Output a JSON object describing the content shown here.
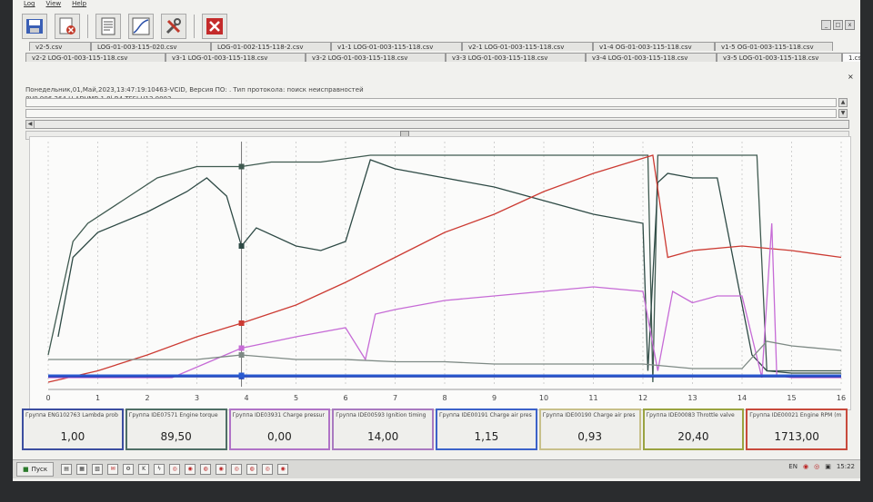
{
  "menu": [
    "Log",
    "View",
    "Help"
  ],
  "toolbar": {
    "icons": [
      "save-icon",
      "delete-icon",
      "notes-icon",
      "graph-icon",
      "settings-icon",
      "exit-icon"
    ]
  },
  "tabs": {
    "row1": [
      "v2-5.csv",
      "LOG-01-003-115-020.csv",
      "LOG-01-002-115-118-2.csv",
      "v1-1 LOG-01-003-115-118.csv",
      "v2-1 LOG-01-003-115-118.csv",
      "v1-4 OG-01-003-115-118.csv",
      "v1-5 OG-01-003-115-118.csv"
    ],
    "row2": [
      "v2-2 LOG-01-003-115-118.csv",
      "v3-1 LOG-01-003-115-118.csv",
      "v3-2 LOG-01-003-115-118.csv",
      "v3-3 LOG-01-003-115-118.csv",
      "v3-4 LOG-01-003-115-118.csv",
      "v3-5 LOG-01-003-115-118.csv",
      "1.csv"
    ]
  },
  "info": {
    "line1": "Понедельник,01,Май,2023,13:47:19:10463-VCID, Версия ПО: . Тип протокола: поиск неисправностей",
    "line2": "8V0 906 264 H ADVMB 1.8l R4 TFSI  H13 0003"
  },
  "chart_data": {
    "type": "line",
    "x_ticks": [
      0,
      1,
      2,
      3,
      4,
      5,
      6,
      7,
      8,
      9,
      10,
      11,
      12,
      13,
      14,
      15,
      16
    ],
    "xlim": [
      0,
      16
    ],
    "cursor_x": 3.9,
    "grid": true,
    "series": [
      {
        "color": "#3f5a50",
        "x": [
          0,
          0.5,
          0.8,
          1.5,
          2.2,
          3,
          3.5,
          3.9,
          4.5,
          5.5,
          6.5,
          7,
          8,
          9,
          10,
          11,
          12.1,
          12.2,
          12.3,
          14.3,
          14.5,
          15,
          16
        ],
        "y": [
          0.12,
          0.62,
          0.7,
          0.8,
          0.9,
          0.95,
          0.95,
          0.95,
          0.97,
          0.97,
          1.0,
          1.0,
          1.0,
          1.0,
          1.0,
          1.0,
          1.0,
          0.0,
          1.0,
          1.0,
          0.05,
          0.05,
          0.05
        ]
      },
      {
        "color": "#2e4a45",
        "x": [
          0.2,
          0.5,
          1.0,
          2.0,
          2.8,
          3.2,
          3.6,
          3.9,
          4.2,
          5.0,
          5.5,
          6.0,
          6.5,
          7,
          8,
          9,
          10,
          11,
          12.0,
          12.1,
          12.3,
          12.5,
          13,
          13.5,
          14.2,
          14.5,
          15,
          16
        ],
        "y": [
          0.2,
          0.55,
          0.66,
          0.75,
          0.84,
          0.9,
          0.82,
          0.6,
          0.68,
          0.6,
          0.58,
          0.62,
          0.98,
          0.94,
          0.9,
          0.86,
          0.8,
          0.74,
          0.7,
          0.05,
          0.88,
          0.92,
          0.9,
          0.9,
          0.12,
          0.05,
          0.04,
          0.04
        ]
      },
      {
        "color": "#cc3b33",
        "x": [
          0,
          1,
          2,
          3,
          3.9,
          5,
          6,
          7,
          8,
          9,
          10,
          11,
          12.2,
          12.5,
          13,
          14,
          15,
          16
        ],
        "y": [
          0.0,
          0.05,
          0.12,
          0.2,
          0.26,
          0.34,
          0.44,
          0.55,
          0.66,
          0.74,
          0.84,
          0.92,
          1.0,
          0.55,
          0.58,
          0.6,
          0.58,
          0.55
        ]
      },
      {
        "color": "#c66bd6",
        "x": [
          0,
          2.5,
          3.9,
          5,
          6,
          6.4,
          6.6,
          7,
          8,
          9,
          10,
          11,
          12,
          12.3,
          12.6,
          13,
          13.5,
          14,
          14.4,
          14.6,
          14.7,
          15,
          16
        ],
        "y": [
          0.02,
          0.02,
          0.15,
          0.2,
          0.24,
          0.1,
          0.3,
          0.32,
          0.36,
          0.38,
          0.4,
          0.42,
          0.4,
          0.05,
          0.4,
          0.35,
          0.38,
          0.38,
          0.02,
          0.7,
          0.03,
          0.02,
          0.02
        ]
      },
      {
        "color": "#7e8a85",
        "x": [
          0,
          1,
          2,
          3,
          3.9,
          5,
          6,
          7,
          8,
          9,
          10,
          11,
          12,
          13,
          14,
          14.5,
          15,
          16
        ],
        "y": [
          0.1,
          0.1,
          0.1,
          0.1,
          0.12,
          0.1,
          0.1,
          0.09,
          0.09,
          0.08,
          0.08,
          0.08,
          0.08,
          0.06,
          0.06,
          0.18,
          0.16,
          0.14
        ]
      },
      {
        "color": "#1f3db3",
        "x": [
          0,
          16
        ],
        "y": [
          0.025,
          0.025
        ]
      },
      {
        "color": "#2a5bd1",
        "x": [
          0,
          16
        ],
        "y": [
          0.03,
          0.03
        ]
      }
    ]
  },
  "tiles": [
    {
      "title": "Группа ENG102763 Lambda prob",
      "value": "1,00",
      "color": "#3c4ea0"
    },
    {
      "title": "Группа IDE07571 Engine torque",
      "value": "89,50",
      "color": "#4f6f66"
    },
    {
      "title": "Группа IDE03931 Charge pressur",
      "value": "0,00",
      "color": "#b073c7"
    },
    {
      "title": "Группа IDE00593 Ignition timing",
      "value": "14,00",
      "color": "#a97ac0"
    },
    {
      "title": "Группа IDE00191 Charge air pres",
      "value": "1,15",
      "color": "#3c62c9"
    },
    {
      "title": "Группа IDE00190 Charge air pres",
      "value": "0,93",
      "color": "#c8c08a"
    },
    {
      "title": "Группа IDE00083 Throttle valve",
      "value": "20,40",
      "color": "#9aa341"
    },
    {
      "title": "Группа IDE00021 Engine RPM  (m",
      "value": "1713,00",
      "color": "#c84a3c"
    }
  ],
  "taskbar": {
    "start_label": "Пуск",
    "lang": "EN",
    "clock": "15:22"
  }
}
